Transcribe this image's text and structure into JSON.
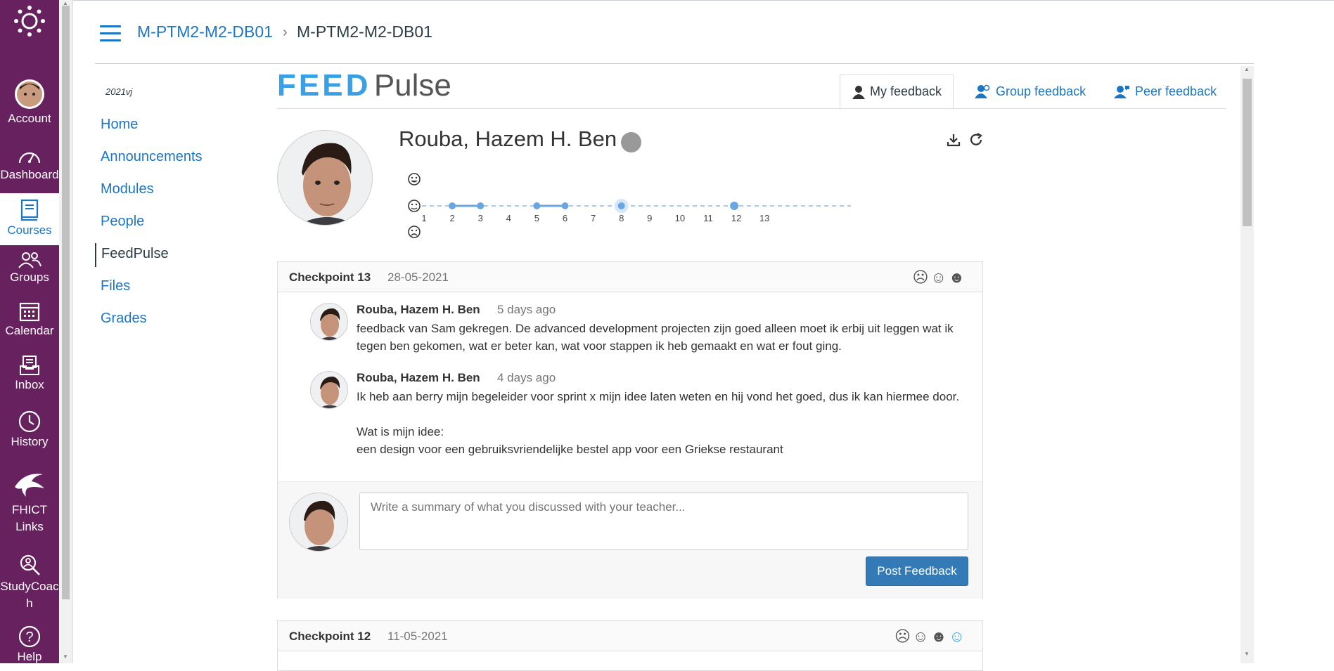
{
  "global_nav": {
    "items": [
      {
        "label": "Account",
        "icon": "avatar"
      },
      {
        "label": "Dashboard",
        "icon": "speedometer-icon"
      },
      {
        "label": "Courses",
        "icon": "book-icon"
      },
      {
        "label": "Groups",
        "icon": "people-icon"
      },
      {
        "label": "Calendar",
        "icon": "calendar-icon"
      },
      {
        "label": "Inbox",
        "icon": "inbox-icon"
      },
      {
        "label": "History",
        "icon": "clock-icon"
      },
      {
        "label": "FHICT Links",
        "icon": "dolphin-icon"
      },
      {
        "label": "StudyCoach",
        "icon": "search-person-icon"
      },
      {
        "label": "Help",
        "icon": "question-icon"
      }
    ]
  },
  "breadcrumb": {
    "course": "M-PTM2-M2-DB01",
    "separator": "›",
    "current": "M-PTM2-M2-DB01"
  },
  "course_nav": {
    "term": "2021vj",
    "items": [
      "Home",
      "Announcements",
      "Modules",
      "People",
      "FeedPulse",
      "Files",
      "Grades"
    ]
  },
  "feedpulse": {
    "logo": {
      "feed": "FEED",
      "pulse": "Pulse"
    },
    "tabs": [
      "My feedback",
      "Group feedback",
      "Peer feedback"
    ],
    "student_name": "Rouba, Hazem H. Ben",
    "timeline": {
      "labels": [
        "1",
        "2",
        "3",
        "4",
        "5",
        "6",
        "7",
        "8",
        "9",
        "10",
        "11",
        "12",
        "13"
      ],
      "points": [
        2,
        3,
        5,
        6,
        8,
        12
      ],
      "highlighted": 8
    },
    "checkpoints": [
      {
        "title": "Checkpoint 13",
        "date": "28-05-2021",
        "comments": [
          {
            "author": "Rouba, Hazem H. Ben",
            "ago": "5 days ago",
            "text": "feedback van Sam gekregen. De advanced development projecten zijn goed alleen moet ik erbij uit leggen wat ik tegen ben gekomen, wat er beter kan, wat voor stappen ik heb gemaakt en wat er fout ging."
          },
          {
            "author": "Rouba, Hazem H. Ben",
            "ago": "4 days ago",
            "text": "Ik heb aan berry mijn begeleider voor sprint x mijn idee laten weten en hij vond het goed, dus ik kan hiermee door.\n\nWat is mijn idee:\neen design voor een gebruiksvriendelijke bestel app voor een Griekse restaurant"
          }
        ],
        "composer_placeholder": "Write a summary of what you discussed with your teacher...",
        "post_label": "Post Feedback"
      },
      {
        "title": "Checkpoint 12",
        "date": "11-05-2021"
      }
    ]
  },
  "colors": {
    "nav_bg": "#66215e",
    "link": "#1d76c4",
    "primary_btn": "#337ab7",
    "logo_blue": "#3aa0e6"
  }
}
